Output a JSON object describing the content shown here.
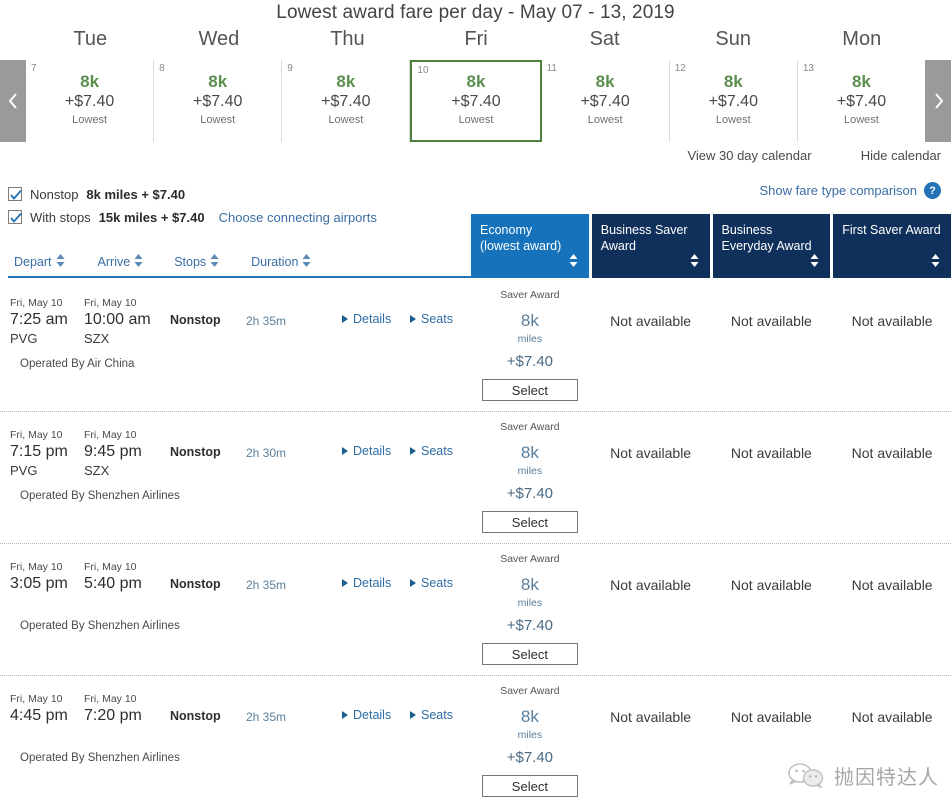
{
  "calendar": {
    "title": "Lowest award fare per day - May 07 - 13, 2019",
    "prev_label": "‹",
    "next_label": "›",
    "days": [
      {
        "dow": "Tue",
        "daynum": "7",
        "miles": "8k",
        "tax": "+$7.40",
        "tag": "Lowest",
        "selected": false
      },
      {
        "dow": "Wed",
        "daynum": "8",
        "miles": "8k",
        "tax": "+$7.40",
        "tag": "Lowest",
        "selected": false
      },
      {
        "dow": "Thu",
        "daynum": "9",
        "miles": "8k",
        "tax": "+$7.40",
        "tag": "Lowest",
        "selected": false
      },
      {
        "dow": "Fri",
        "daynum": "10",
        "miles": "8k",
        "tax": "+$7.40",
        "tag": "Lowest",
        "selected": true
      },
      {
        "dow": "Sat",
        "daynum": "11",
        "miles": "8k",
        "tax": "+$7.40",
        "tag": "Lowest",
        "selected": false
      },
      {
        "dow": "Sun",
        "daynum": "12",
        "miles": "8k",
        "tax": "+$7.40",
        "tag": "Lowest",
        "selected": false
      },
      {
        "dow": "Mon",
        "daynum": "13",
        "miles": "8k",
        "tax": "+$7.40",
        "tag": "Lowest",
        "selected": false
      }
    ],
    "view_30_day": "View 30 day calendar",
    "hide_calendar": "Hide calendar",
    "fare_compare": "Show fare type comparison",
    "help_glyph": "?"
  },
  "filters": [
    {
      "label": "Nonstop",
      "price": "8k miles + $7.40",
      "link": "",
      "checked": true
    },
    {
      "label": "With stops",
      "price": "15k miles + $7.40",
      "link": "Choose connecting airports",
      "checked": true
    }
  ],
  "sort_columns": [
    {
      "label": "Depart"
    },
    {
      "label": "Arrive"
    },
    {
      "label": "Stops"
    },
    {
      "label": "Duration"
    }
  ],
  "fare_tabs": [
    {
      "line1": "Economy",
      "line2": "(lowest award)",
      "active": true
    },
    {
      "line1": "Business Saver",
      "line2": "Award",
      "active": false
    },
    {
      "line1": "Business",
      "line2": "Everyday Award",
      "active": false
    },
    {
      "line1": "First Saver Award",
      "line2": "",
      "active": false
    }
  ],
  "labels": {
    "details": "Details",
    "seats": "Seats",
    "select": "Select",
    "not_available": "Not available",
    "saver_award": "Saver Award",
    "miles_unit": "miles"
  },
  "flights": [
    {
      "depart_date": "Fri, May 10",
      "depart_time": "7:25 am",
      "depart_apt": "PVG",
      "arrive_date": "Fri, May 10",
      "arrive_time": "10:00 am",
      "arrive_apt": "SZX",
      "stops": "Nonstop",
      "duration": "2h 35m",
      "operated": "Operated By Air China",
      "fares": [
        {
          "type": "Saver Award",
          "miles": "8k",
          "tax": "+$7.40",
          "available": true
        },
        {
          "available": false
        },
        {
          "available": false
        },
        {
          "available": false
        }
      ]
    },
    {
      "depart_date": "Fri, May 10",
      "depart_time": "7:15 pm",
      "depart_apt": "PVG",
      "arrive_date": "Fri, May 10",
      "arrive_time": "9:45 pm",
      "arrive_apt": "SZX",
      "stops": "Nonstop",
      "duration": "2h 30m",
      "operated": "Operated By Shenzhen Airlines",
      "fares": [
        {
          "type": "Saver Award",
          "miles": "8k",
          "tax": "+$7.40",
          "available": true
        },
        {
          "available": false
        },
        {
          "available": false
        },
        {
          "available": false
        }
      ]
    },
    {
      "depart_date": "Fri, May 10",
      "depart_time": "3:05 pm",
      "depart_apt": "",
      "arrive_date": "Fri, May 10",
      "arrive_time": "5:40 pm",
      "arrive_apt": "",
      "stops": "Nonstop",
      "duration": "2h 35m",
      "operated": "Operated By Shenzhen Airlines",
      "fares": [
        {
          "type": "Saver Award",
          "miles": "8k",
          "tax": "+$7.40",
          "available": true
        },
        {
          "available": false
        },
        {
          "available": false
        },
        {
          "available": false
        }
      ]
    },
    {
      "depart_date": "Fri, May 10",
      "depart_time": "4:45 pm",
      "depart_apt": "",
      "arrive_date": "Fri, May 10",
      "arrive_time": "7:20 pm",
      "arrive_apt": "",
      "stops": "Nonstop",
      "duration": "2h 35m",
      "operated": "Operated By Shenzhen Airlines",
      "fares": [
        {
          "type": "Saver Award",
          "miles": "8k",
          "tax": "+$7.40",
          "available": true
        },
        {
          "available": false
        },
        {
          "available": false
        },
        {
          "available": false
        }
      ]
    }
  ],
  "watermark": {
    "text": "抛因特达人"
  },
  "colors": {
    "green": "#5a8f4e",
    "selected_border": "#4f7f3f",
    "tab_active": "#1673bb",
    "tab_inactive": "#10305c",
    "link": "#3a6ea5"
  }
}
